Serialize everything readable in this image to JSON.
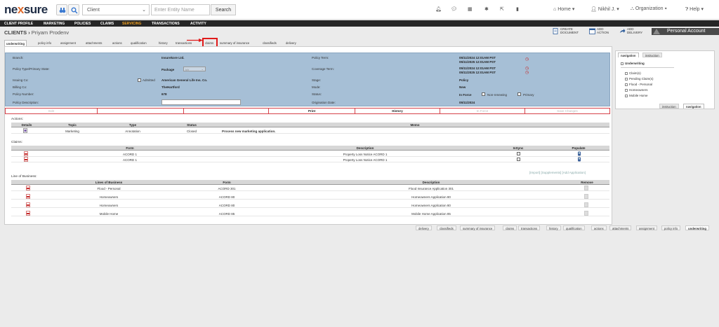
{
  "header": {
    "logo_a": "ne",
    "logo_x": "x",
    "logo_b": "sure",
    "select_value": "Client",
    "entity_placeholder": "Enter Entity Name",
    "search_label": "Search",
    "home_label": "Home",
    "user_label": "Nikhil J.",
    "org_label": "Organization",
    "help_label": "Help"
  },
  "nav": {
    "items": [
      "CLIENT PROFILE",
      "MARKETING",
      "POLICIES",
      "CLAIMS",
      "SERVICING",
      "TRANSACTIONS",
      "ACTIVITY"
    ],
    "active": "SERVICING"
  },
  "breadcrumb": {
    "root": "CLIENTS",
    "sep": "›",
    "name": "Priyam Prodenv"
  },
  "actions": {
    "create_document": [
      "CREATE",
      "DOCUMENT"
    ],
    "add_action": [
      "ADD",
      "ACTION"
    ],
    "add_delivery": [
      "ADD",
      "DELIVERY"
    ],
    "account_label": "Personal Account"
  },
  "tabs": [
    "underwriting",
    "policy info",
    "assignment",
    "attachments",
    "actions",
    "qualification",
    "history",
    "transactions",
    "claims",
    "summary of insurance",
    "classifieds",
    "delivery"
  ],
  "info": {
    "branch_label": "Branch:",
    "branch_value": "Insurekore Ltd.",
    "policy_type_label": "Policy Type/Primary State:",
    "package_label": "Package",
    "package_value": "NY",
    "issuing_label": "Issuing Co:",
    "admitted_label": "Admitted",
    "issuing_value": "American General Life Ins. Co.",
    "billing_label": "Billing Co:",
    "billing_value": "TheHartford",
    "policy_number_label": "Policy Number:",
    "policy_number_value": "678",
    "policy_desc_label": "Policy Description:",
    "policy_term_label": "Policy Term:",
    "policy_term_from": "05/11/2024  12:01AM PST",
    "policy_term_to": "05/11/2025  12:01AM PST",
    "coverage_term_label": "Coverage Term:",
    "coverage_from": "05/11/2024  12:01AM PST",
    "coverage_to": "05/11/2025  12:01AM PST",
    "stage_label": "Stage:",
    "stage_value": "Policy",
    "mode_label": "Mode:",
    "mode_value": "New",
    "status_label": "Status:",
    "status_value": "In Force",
    "nonrenewing_label": "Non-renewing",
    "primary_label": "Primary",
    "origination_label": "Origination Date:",
    "origination_value": "05/11/2024"
  },
  "buttons": [
    "Edit",
    "",
    "",
    "Print",
    "History",
    "In Force",
    "Save Changes"
  ],
  "actions_section": {
    "title": "Actions:",
    "headers": [
      "Details",
      "Topic",
      "Type",
      "Status",
      "Memo"
    ],
    "rows": [
      {
        "topic": "Marketing",
        "type": "Annotation",
        "status": "Closed",
        "memo": "Process new marketing application."
      }
    ]
  },
  "claims_section": {
    "title": "Claims:",
    "headers": [
      "Form",
      "Description",
      "InSync",
      "Populate"
    ],
    "rows": [
      {
        "form": "ACORD 1",
        "description": "Property Loss Notice ACORD 1"
      },
      {
        "form": "ACORD 1",
        "description": "Property Loss Notice ACORD 1"
      }
    ]
  },
  "links": "[Import] [Supplements] [Add Application]",
  "lob_section": {
    "title": "Line of Business:",
    "headers": [
      "Lines of Business",
      "Form",
      "Description",
      "Remove"
    ],
    "rows": [
      {
        "lob": "Flood - Personal",
        "form": "ACORD 301",
        "description": "Flood Insurance Application 301"
      },
      {
        "lob": "Homeowners",
        "form": "ACORD 80",
        "description": "Homeowners Application 80"
      },
      {
        "lob": "Homeowners",
        "form": "ACORD 80",
        "description": "Homeowners Application 80"
      },
      {
        "lob": "Mobile Home",
        "form": "ACORD 85",
        "description": "Mobile Home Application 85"
      }
    ]
  },
  "sidebar": {
    "tab_nav": "navigation",
    "tab_instr": "instruction",
    "root": "Underwriting",
    "items": [
      "Claim(s)",
      "Pending Claim(s)",
      "Flood - Personal",
      "Homeowners",
      "Mobile Home"
    ],
    "btab_instr": "instruction",
    "btab_nav": "navigation"
  },
  "bottom_tabs": [
    "delivery",
    "classifieds",
    "summary of insurance",
    "claims",
    "transactions",
    "history",
    "qualification",
    "actions",
    "attachments",
    "assignment",
    "policy info",
    "underwriting"
  ]
}
